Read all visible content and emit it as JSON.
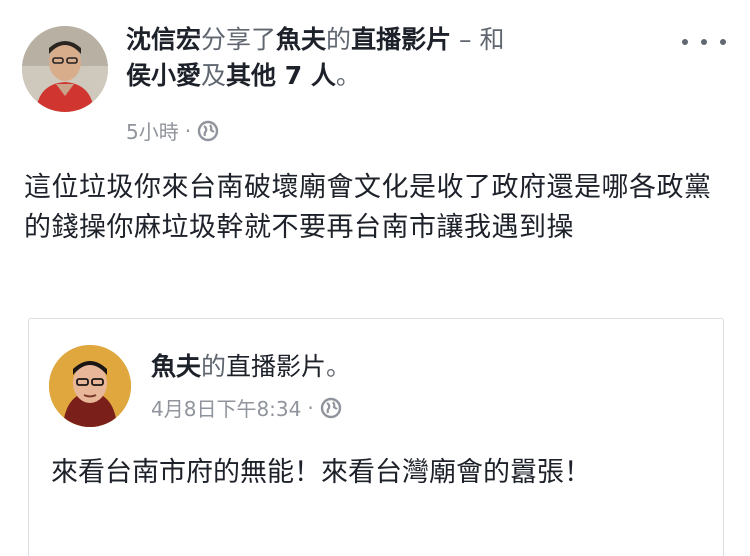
{
  "post": {
    "author": "沈信宏",
    "shared_verb": "分享了",
    "shared_page": "魚夫",
    "possessive": "的",
    "content_type": "直播影片",
    "with_dash": " – 和",
    "tagged_user": "侯小愛",
    "and_word": "及",
    "others": "其他 7 人",
    "period": "。",
    "time": "5小時",
    "dot": "·",
    "text": "這位垃圾你來台南破壞廟會文化是收了政府還是哪各政黨的錢操你麻垃圾幹就不要再台南市讓我遇到操"
  },
  "shared": {
    "page_name": "魚夫",
    "possessive": "的",
    "content_type": "直播影片",
    "period": "。",
    "time": "4月8日下午8:34",
    "dot": "·",
    "text": "來看台南市府的無能！來看台灣廟會的囂張！"
  },
  "icons": {
    "more": "more-options-icon",
    "privacy": "globe-icon"
  },
  "colors": {
    "text": "#1d2129",
    "secondary": "#606770",
    "meta": "#90949c",
    "border": "#dddfe2"
  }
}
